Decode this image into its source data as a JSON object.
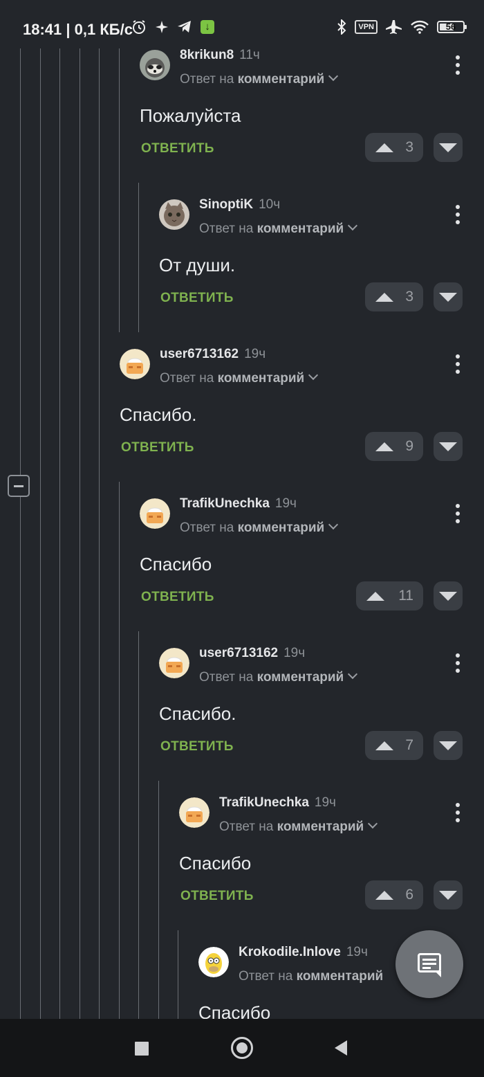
{
  "status_bar": {
    "time": "18:41",
    "network_speed": "| 0,1 КБ/с",
    "vpn": "VPN",
    "battery": "56",
    "icons": [
      "alarm-icon",
      "sparkle-icon",
      "telegram-icon",
      "download-icon",
      "bluetooth-icon",
      "vpn-icon",
      "airplane-icon",
      "wifi-icon",
      "battery-icon"
    ]
  },
  "labels": {
    "reply_prefix": "Ответ на",
    "reply_target": "комментарий",
    "reply_button": "ОТВЕТИТЬ"
  },
  "colors": {
    "background": "#23262b",
    "reply_green": "#7fb24f",
    "vote_bg": "#3a3e44"
  },
  "comments": [
    {
      "author": "8krikun8",
      "time": "11ч",
      "text": "Пожалуйста",
      "votes": "3",
      "avatar": "raccoon"
    },
    {
      "author": "SinoptiK",
      "time": "10ч",
      "text": "От души.",
      "votes": "3",
      "avatar": "cat"
    },
    {
      "author": "user6713162",
      "time": "19ч",
      "text": "Спасибо.",
      "votes": "9",
      "avatar": "default-pikabu"
    },
    {
      "author": "TrafikUnechka",
      "time": "19ч",
      "text": "Спасибо",
      "votes": "11",
      "avatar": "default-pikabu"
    },
    {
      "author": "user6713162",
      "time": "19ч",
      "text": "Спасибо.",
      "votes": "7",
      "avatar": "default-pikabu"
    },
    {
      "author": "TrafikUnechka",
      "time": "19ч",
      "text": "Спасибо",
      "votes": "6",
      "avatar": "default-pikabu"
    },
    {
      "author": "Krokodile.Inlove",
      "time": "19ч",
      "text": "Спасибо",
      "votes": "",
      "avatar": "homer"
    }
  ],
  "fab": {
    "icon": "comment-icon"
  },
  "nav_bar": {
    "icons": [
      "recent-apps-icon",
      "home-icon",
      "back-icon"
    ]
  }
}
